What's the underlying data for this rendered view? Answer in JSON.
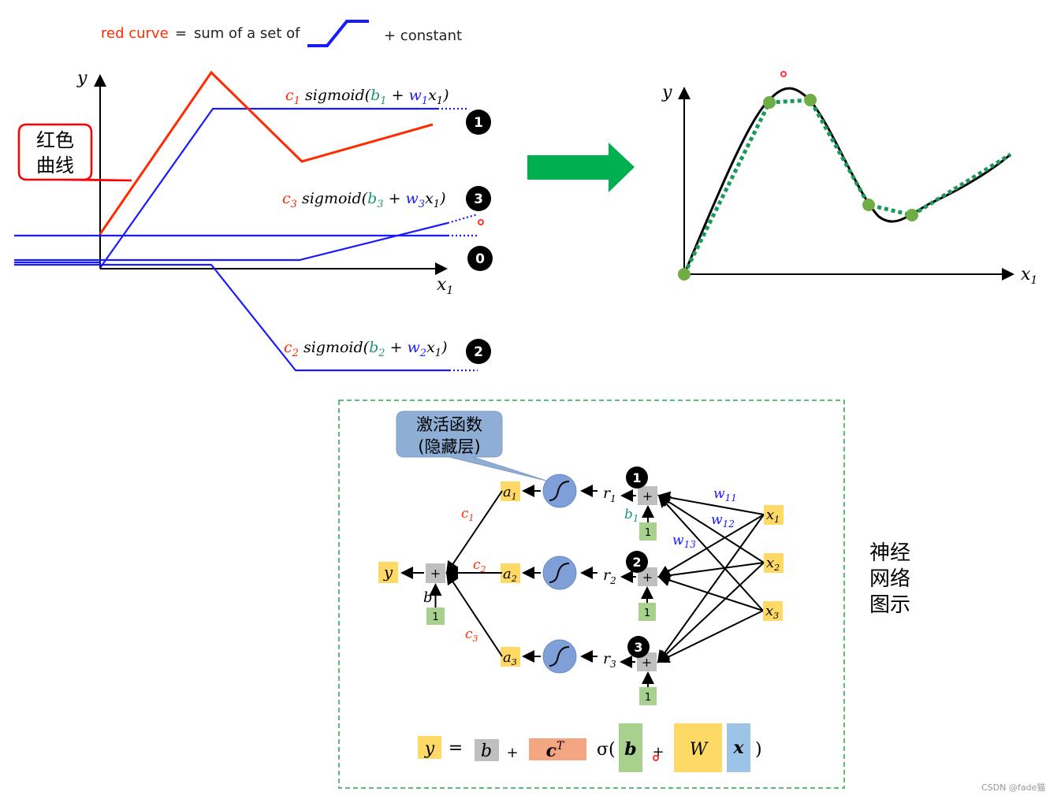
{
  "header": {
    "red_label": "red curve",
    "equals": "=",
    "sum_text": "sum of a set of",
    "constant": "+ constant"
  },
  "colors": {
    "red": "#ff2a00",
    "blue": "#1a1aff",
    "green": "#00b050",
    "formula_green": "#1a9a6a",
    "dash_box": "#27a844"
  },
  "left_chart": {
    "y_label": "y",
    "x_label": "x",
    "x_sub": "1",
    "callout": [
      "红色",
      "曲线"
    ],
    "badges": [
      "1",
      "3",
      "0",
      "2"
    ],
    "formulas": [
      {
        "c": "c",
        "i": "1",
        "s": " sigmoid(",
        "b": "b",
        "p": " + ",
        "w": "w",
        "x": "x",
        "xi": "1",
        "e": ")"
      },
      {
        "c": "c",
        "i": "3",
        "s": " sigmoid(",
        "b": "b",
        "p": " + ",
        "w": "w",
        "x": "x",
        "xi": "1",
        "e": ")"
      },
      {
        "c": "c",
        "i": "2",
        "s": " sigmoid(",
        "b": "b",
        "p": " + ",
        "w": "w",
        "x": "x",
        "xi": "1",
        "e": ")"
      }
    ]
  },
  "right_chart": {
    "y_label": "y",
    "x_label": "x",
    "x_sub": "1"
  },
  "network": {
    "callout": [
      "激活函数",
      "(隐藏层)"
    ],
    "output": "y",
    "plus": "+",
    "one": "1",
    "bias_label": "b",
    "a_labels": [
      "a",
      "a",
      "a"
    ],
    "subs": [
      "1",
      "2",
      "3"
    ],
    "c_labels": [
      "c",
      "c",
      "c"
    ],
    "r_labels": [
      "r",
      "r",
      "r"
    ],
    "x_labels": [
      "x",
      "x",
      "x"
    ],
    "badges": [
      "1",
      "2",
      "3"
    ],
    "w_labels": [
      {
        "t": "w",
        "s": "11"
      },
      {
        "t": "w",
        "s": "12"
      },
      {
        "t": "w",
        "s": "13"
      }
    ],
    "b1": {
      "t": "b",
      "s": "1"
    }
  },
  "matrix_formula": {
    "y": "y",
    "eq": "=",
    "b": "b",
    "plus": "+",
    "c": "c",
    "T": "T",
    "sigma": "σ(",
    "b_vec": "b",
    "plus2": "+",
    "W": "W",
    "x": "x",
    "close": ")"
  },
  "side_label": [
    "神经",
    "网络",
    "图示"
  ],
  "watermark": "CSDN @fade猫"
}
